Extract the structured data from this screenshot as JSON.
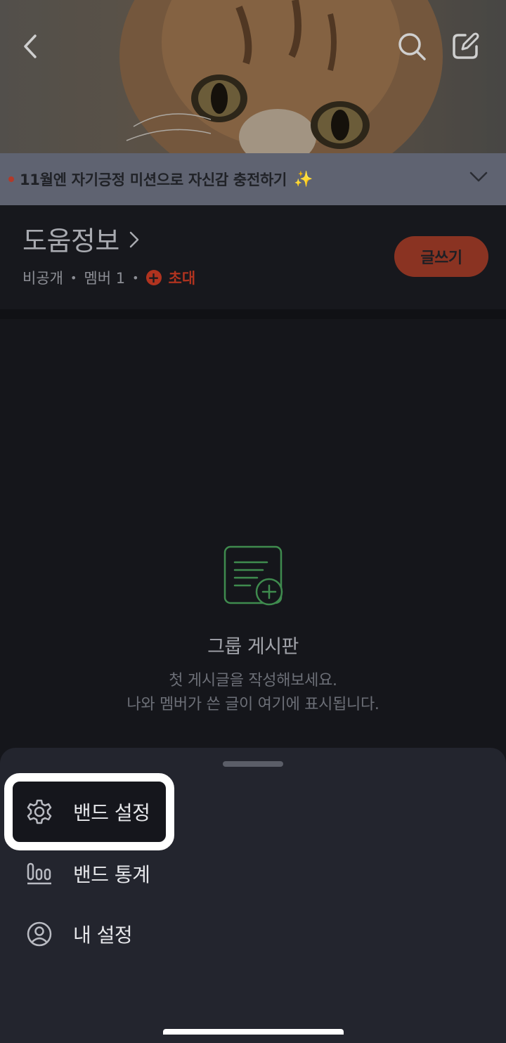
{
  "header": {
    "back_icon": "chevron-left-icon",
    "search_icon": "search-icon",
    "compose_icon": "edit-icon"
  },
  "notice": {
    "text": "11월엔 자기긍정 미션으로 자신감 충전하기",
    "sparkle": "✨",
    "expand_icon": "chevron-down-icon"
  },
  "group": {
    "name": "도움정보",
    "privacy": "비공개",
    "members": "멤버 1",
    "invite_label": "초대",
    "write_button": "글쓰기"
  },
  "empty_state": {
    "icon": "document-add-icon",
    "title": "그룹 게시판",
    "line1": "첫 게시글을 작성해보세요.",
    "line2": "나와 멤버가 쓴 글이 여기에 표시됩니다."
  },
  "sheet": {
    "items": [
      {
        "label": "밴드 설정",
        "icon": "gear-icon"
      },
      {
        "label": "밴드 통계",
        "icon": "bar-chart-icon"
      },
      {
        "label": "내 설정",
        "icon": "user-circle-icon"
      }
    ]
  },
  "colors": {
    "accent": "#b0331f",
    "empty_icon": "#3f8b4e",
    "sheet_bg": "#23252e"
  }
}
